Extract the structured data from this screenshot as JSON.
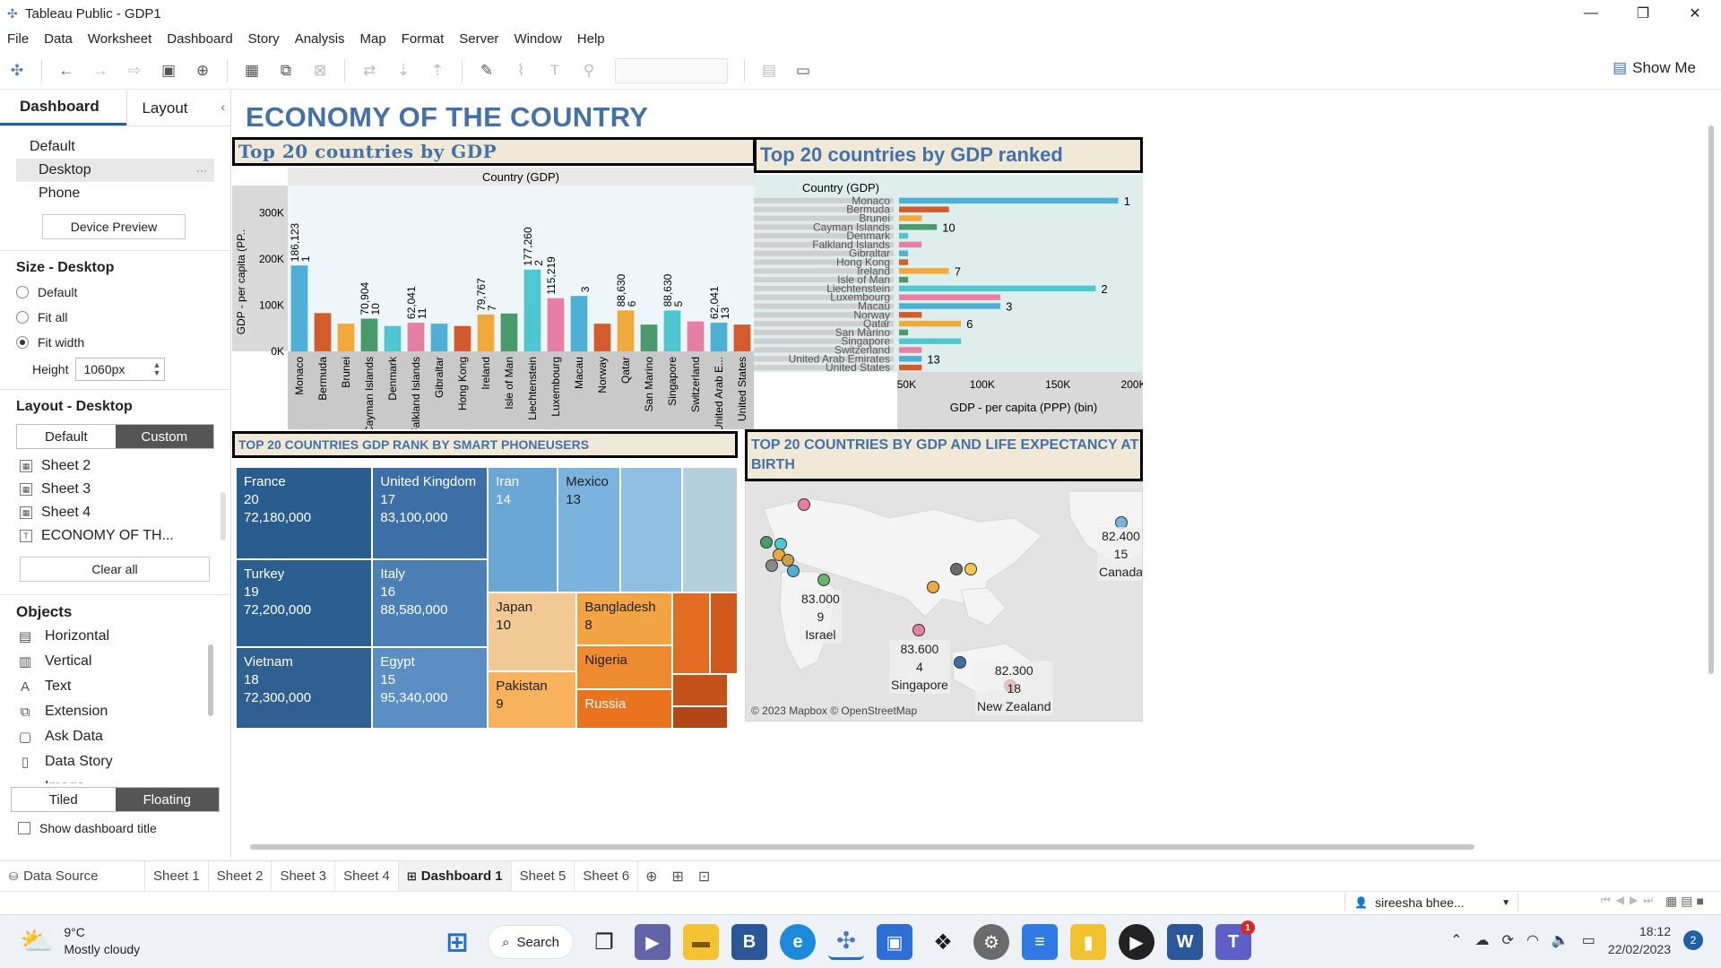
{
  "window": {
    "title": "Tableau Public - GDP1",
    "controls": [
      "—",
      "❐",
      "✕"
    ]
  },
  "menu": [
    "File",
    "Data",
    "Worksheet",
    "Dashboard",
    "Story",
    "Analysis",
    "Map",
    "Format",
    "Server",
    "Window",
    "Help"
  ],
  "toolbar": {
    "show_me": "Show Me"
  },
  "left_pane": {
    "tab_dashboard": "Dashboard",
    "tab_layout": "Layout",
    "device_default": "Default",
    "device_desktop": "Desktop",
    "device_phone": "Phone",
    "device_preview": "Device Preview",
    "size_heading": "Size - Desktop",
    "size_options": [
      "Default",
      "Fit all",
      "Fit width"
    ],
    "size_selected": "Fit width",
    "height_label": "Height",
    "height_value": "1060px",
    "layout_heading": "Layout - Desktop",
    "layout_default": "Default",
    "layout_custom": "Custom",
    "sheets": [
      "Sheet 2",
      "Sheet 3",
      "Sheet 4",
      "ECONOMY OF TH..."
    ],
    "clear_all": "Clear all",
    "objects_heading": "Objects",
    "objects": [
      {
        "label": "Horizontal",
        "icon": "horizontal-icon",
        "glyph": "▤"
      },
      {
        "label": "Vertical",
        "icon": "vertical-icon",
        "glyph": "▥"
      },
      {
        "label": "Text",
        "icon": "text-icon",
        "glyph": "A"
      },
      {
        "label": "Extension",
        "icon": "extension-icon",
        "glyph": "⧉"
      },
      {
        "label": "Ask Data",
        "icon": "ask-data-icon",
        "glyph": "▢"
      },
      {
        "label": "Data Story",
        "icon": "data-story-icon",
        "glyph": "▯"
      },
      {
        "label": "Image",
        "icon": "image-icon",
        "glyph": "▭"
      }
    ],
    "tiled": "Tiled",
    "floating": "Floating",
    "show_title": "Show dashboard title"
  },
  "dashboard": {
    "title": "ECONOMY OF THE COUNTRY",
    "sheet1_title": "Top 20 countries by GDP",
    "sheet2_title": "Top 20 countries by GDP ranked",
    "sheet3_title": "TOP 20 COUNTRIES GDP RANK BY SMART PHONEUSERS",
    "sheet4_title": "TOP 20 COUNTRIES BY GDP AND LIFE EXPECTANCY AT BIRTH",
    "map_attribution": "© 2023 Mapbox © OpenStreetMap"
  },
  "chart_data": [
    {
      "type": "bar",
      "column_header": "Country (GDP)",
      "ylabel": "GDP - per capita (PP..",
      "ylim": [
        0,
        340000
      ],
      "yticks": [
        "0K",
        "100K",
        "200K",
        "300K"
      ],
      "ytick_values": [
        0,
        100000,
        200000,
        300000
      ],
      "categories": [
        "Monaco",
        "Bermuda",
        "Brunei",
        "Cayman Islands",
        "Denmark",
        "Falkland Islands",
        "Gibraltar",
        "Hong Kong",
        "Ireland",
        "Isle of Man",
        "Liechtenstein",
        "Luxembourg",
        "Macau",
        "Norway",
        "Qatar",
        "San Marino",
        "Singapore",
        "Switzerland",
        "United Arab E...",
        "United States"
      ],
      "values": [
        186123,
        83000,
        60000,
        70904,
        55000,
        62041,
        60000,
        55000,
        79767,
        82000,
        177260,
        115219,
        120000,
        60000,
        88630,
        58000,
        88630,
        65000,
        62041,
        58000
      ],
      "value_labels": [
        "186,123",
        "",
        "",
        "70,904",
        "",
        "62,041",
        "",
        "",
        "79,767",
        "",
        "177,260",
        "115,219",
        "",
        "",
        "88,630",
        "",
        "88,630",
        "",
        "62,041",
        ""
      ],
      "rank_labels": [
        "1",
        "",
        "",
        "10",
        "",
        "11",
        "",
        "",
        "7",
        "",
        "2",
        "",
        "3",
        "",
        "6",
        "",
        "5",
        "",
        "13",
        ""
      ],
      "colors": [
        "#4fb0d6",
        "#d35b2c",
        "#f2a93b",
        "#4a9a6e",
        "#4fc7d1",
        "#e77fa4",
        "#4fb0d6",
        "#d35b2c",
        "#f2a93b",
        "#4a9a6e",
        "#4fc7d1",
        "#e77fa4",
        "#4fb0d6",
        "#d35b2c",
        "#f2a93b",
        "#4a9a6e",
        "#4fc7d1",
        "#e77fa4",
        "#4fb0d6",
        "#d35b2c"
      ]
    },
    {
      "type": "bar",
      "orientation": "horizontal",
      "row_header": "Country (GDP)",
      "xlabel": "GDP - per capita (PPP) (bin)",
      "xlim": [
        45000,
        205000
      ],
      "xticks": [
        "50K",
        "100K",
        "150K",
        "200K"
      ],
      "xtick_values": [
        50000,
        100000,
        150000,
        200000
      ],
      "categories": [
        "Monaco",
        "Bermuda",
        "Brunei",
        "Cayman Islands",
        "Denmark",
        "Falkland Islands",
        "Gibraltar",
        "Hong Kong",
        "Ireland",
        "Isle of Man",
        "Liechtenstein",
        "Luxembourg",
        "Macau",
        "Norway",
        "Qatar",
        "San Marino",
        "Singapore",
        "Switzerland",
        "United Arab Emirates",
        "United States"
      ],
      "values": [
        190000,
        78000,
        60000,
        70000,
        51000,
        60000,
        51000,
        51000,
        78000,
        51000,
        175000,
        112000,
        112000,
        60000,
        86000,
        51000,
        86000,
        60000,
        60000,
        60000
      ],
      "rank_labels": [
        "1",
        "",
        "",
        "10",
        "",
        "",
        "",
        "",
        "7",
        "",
        "2",
        "",
        "3",
        "",
        "6",
        "",
        "",
        "",
        "13",
        ""
      ],
      "colors": [
        "#4fb0d6",
        "#d35b2c",
        "#f2a93b",
        "#4a9a6e",
        "#4fc7d1",
        "#e77fa4",
        "#4fb0d6",
        "#d35b2c",
        "#f2a93b",
        "#4a9a6e",
        "#4fc7d1",
        "#e77fa4",
        "#4fb0d6",
        "#d35b2c",
        "#f2a93b",
        "#4a9a6e",
        "#4fc7d1",
        "#e77fa4",
        "#4fb0d6",
        "#d35b2c"
      ]
    }
  ],
  "treemap": [
    {
      "country": "France",
      "rank": "20",
      "users": "72,180,000",
      "color": "#2a5d8f",
      "dark": true
    },
    {
      "country": "United Kingdom",
      "rank": "17",
      "users": "83,100,000",
      "color": "#3b6fa6",
      "dark": true
    },
    {
      "country": "Iran",
      "rank": "14",
      "users": "",
      "color": "#6aa6d6",
      "dark": true
    },
    {
      "country": "Mexico",
      "rank": "13",
      "users": "",
      "color": "#7ab3de",
      "dark": false
    },
    {
      "country": "",
      "rank": "",
      "users": "",
      "color": "#8fc0e3",
      "dark": false
    },
    {
      "country": "",
      "rank": "",
      "users": "",
      "color": "#b3cedc",
      "dark": false
    },
    {
      "country": "Turkey",
      "rank": "19",
      "users": "72,200,000",
      "color": "#2c5f91",
      "dark": true
    },
    {
      "country": "Italy",
      "rank": "16",
      "users": "88,580,000",
      "color": "#4b7fb6",
      "dark": true
    },
    {
      "country": "Japan",
      "rank": "10",
      "users": "",
      "color": "#f2c894",
      "dark": false
    },
    {
      "country": "Bangladesh",
      "rank": "8",
      "users": "",
      "color": "#f2a343",
      "dark": false
    },
    {
      "country": "Vietnam",
      "rank": "18",
      "users": "72,300,000",
      "color": "#305f92",
      "dark": true
    },
    {
      "country": "Egypt",
      "rank": "15",
      "users": "95,340,000",
      "color": "#5b8fc4",
      "dark": true
    },
    {
      "country": "Pakistan",
      "rank": "9",
      "users": "",
      "color": "#f8b25c",
      "dark": false
    },
    {
      "country": "Nigeria",
      "rank": "",
      "users": "",
      "color": "#ee8a2f",
      "dark": false
    },
    {
      "country": "Russia",
      "rank": "",
      "users": "",
      "color": "#e9731f",
      "dark": true
    },
    {
      "country": "",
      "rank": "",
      "users": "",
      "color": "#e26d22",
      "dark": true
    },
    {
      "country": "",
      "rank": "",
      "users": "",
      "color": "#d05a1c",
      "dark": true
    },
    {
      "country": "",
      "rank": "",
      "users": "",
      "color": "#c4501a",
      "dark": true
    },
    {
      "country": "",
      "rank": "",
      "users": "",
      "color": "#b34617",
      "dark": true
    }
  ],
  "map_labels": [
    {
      "value": "82.400",
      "rank": "15",
      "country": "Canada"
    },
    {
      "value": "83.000",
      "rank": "9",
      "country": "Israel"
    },
    {
      "value": "83.600",
      "rank": "4",
      "country": "Singapore"
    },
    {
      "value": "82.300",
      "rank": "18",
      "country": "New Zealand"
    }
  ],
  "sheet_tabs": [
    "Data Source",
    "Sheet 1",
    "Sheet 2",
    "Sheet 3",
    "Sheet 4",
    "Dashboard 1",
    "Sheet 5",
    "Sheet 6"
  ],
  "active_tab": "Dashboard 1",
  "status": {
    "user": "sireesha bhee..."
  },
  "taskbar": {
    "temperature": "9°C",
    "weather": "Mostly cloudy",
    "search": "Search",
    "time": "18:12",
    "date": "22/02/2023",
    "notifications": "2",
    "teams_badge": "1"
  }
}
